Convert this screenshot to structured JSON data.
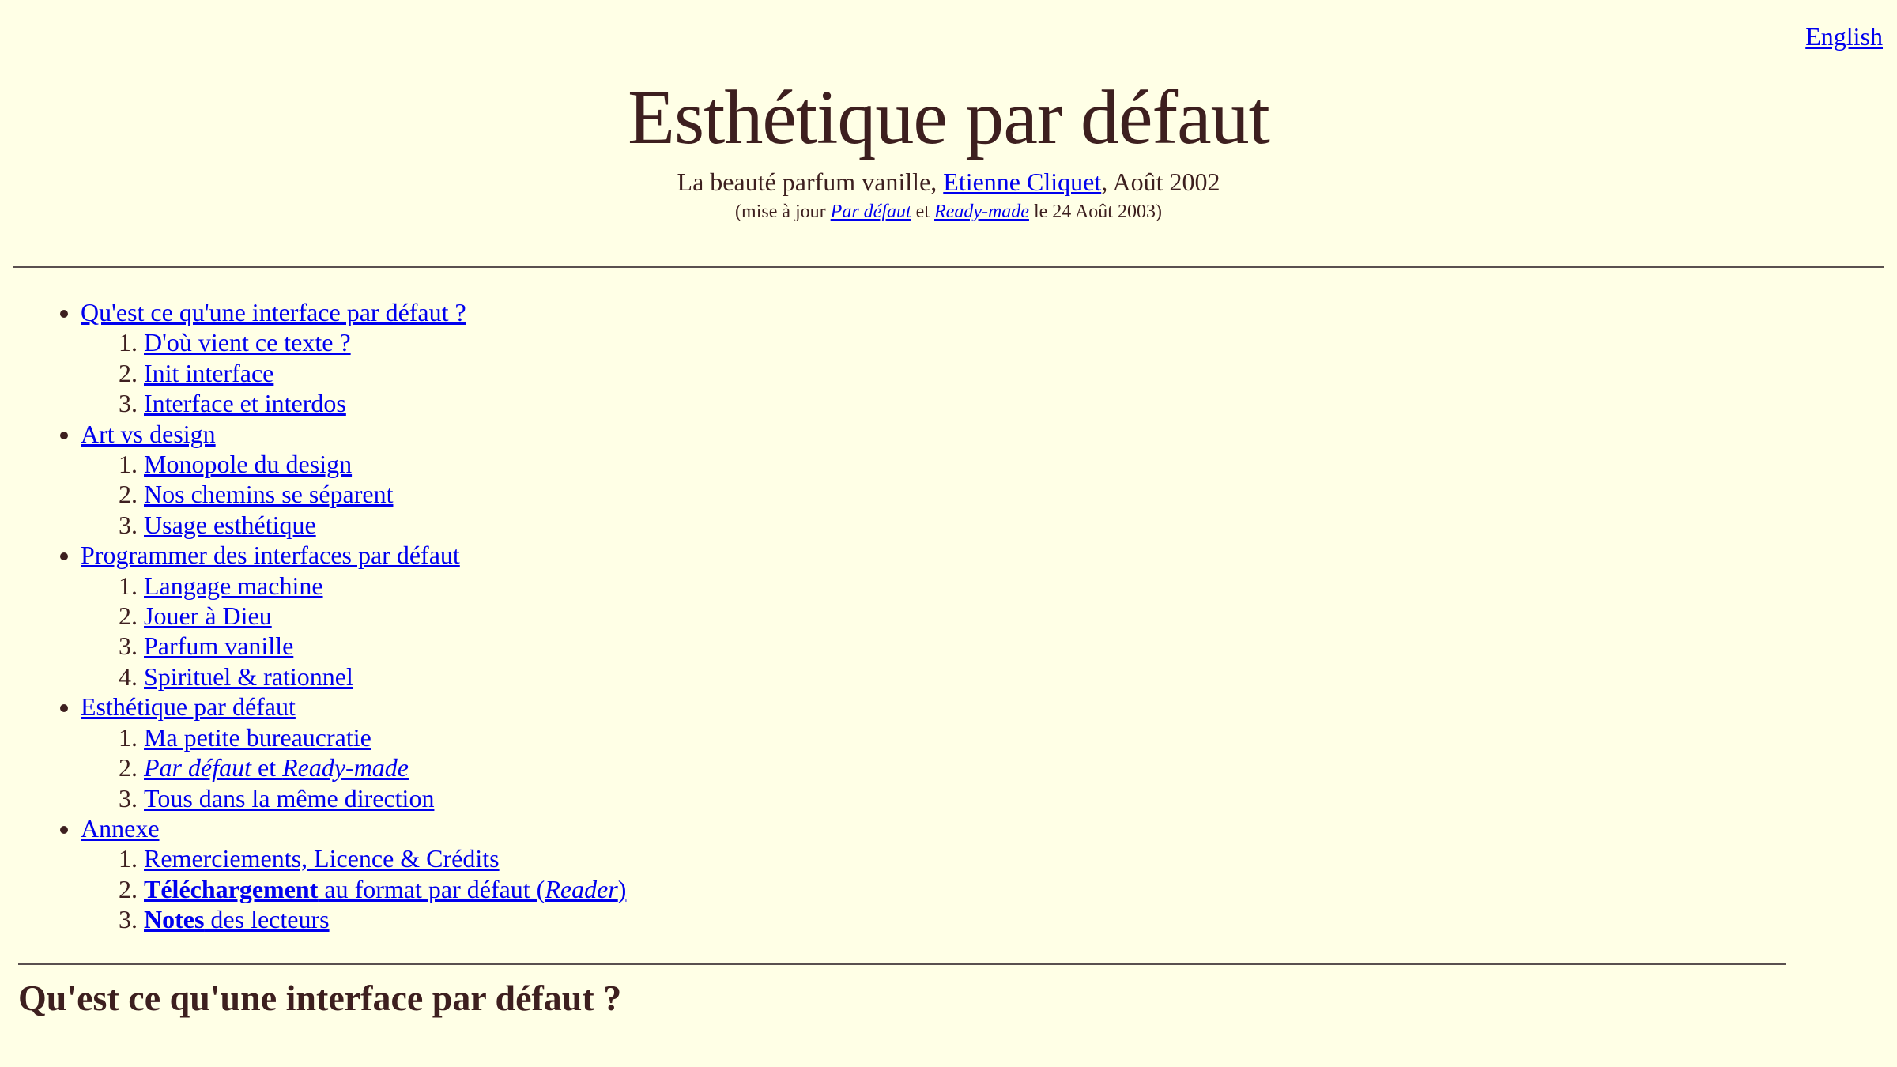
{
  "language_link": "English",
  "header": {
    "title": "Esthétique par défaut",
    "subtitle_prefix": "La beauté parfum vanille, ",
    "author": "Etienne Cliquet",
    "subtitle_suffix": ", Août 2002",
    "update_prefix": "(mise à jour ",
    "update_link1": "Par défaut",
    "update_and": " et ",
    "update_link2": "Ready-made",
    "update_suffix": " le 24 Août 2003)"
  },
  "toc": {
    "sections": [
      {
        "label": "Qu'est ce qu'une interface par défaut ?",
        "items": [
          "D'où vient ce texte ?",
          "Init interface",
          "Interface et interdos"
        ]
      },
      {
        "label": "Art vs design",
        "items": [
          "Monopole du design",
          "Nos chemins se séparent",
          "Usage esthétique"
        ]
      },
      {
        "label": "Programmer des interfaces par défaut",
        "items": [
          "Langage machine",
          "Jouer à Dieu",
          "Parfum vanille",
          "Spirituel & rationnel"
        ]
      },
      {
        "label": "Esthétique par défaut",
        "items": [
          "Ma petite bureaucratie",
          "Par défaut et Ready-made",
          "Tous dans la même direction"
        ]
      },
      {
        "label": "Annexe",
        "items": [
          "Remerciements, Licence & Crédits",
          "Téléchargement au format par défaut (Reader)",
          "Notes des lecteurs"
        ]
      }
    ],
    "rich": {
      "pardefaut_a": "Par défaut",
      "pardefaut_b": " et ",
      "pardefaut_c": "Ready-made",
      "dl_a": "Téléchargement",
      "dl_b": " au format par défaut (",
      "dl_c": "Reader",
      "dl_d": ")",
      "notes_a": "Notes",
      "notes_b": " des lecteurs"
    }
  },
  "section_heading": "Qu'est ce qu'une interface par défaut ?"
}
